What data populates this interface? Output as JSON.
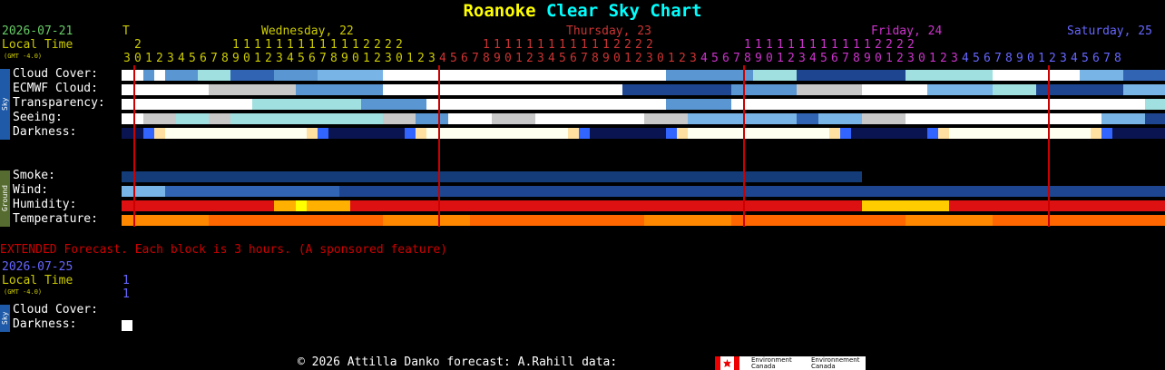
{
  "title": {
    "place": "Roanoke",
    "chart": "Clear Sky Chart"
  },
  "header": {
    "date": "2026-07-21",
    "local_time": "Local Time",
    "gmt": "(GMT -4.0)",
    "days": [
      {
        "label": "T",
        "color": "#cccc00"
      },
      {
        "label": "Wednesday, 22",
        "color": "#cccc00"
      },
      {
        "label": "Thursday, 23",
        "color": "#cc3333"
      },
      {
        "label": "Friday, 24",
        "color": "#cc33cc"
      },
      {
        "label": "Saturday, 25",
        "color": "#6666ff"
      }
    ],
    "hours_line1": " 2        1111111111112222       1111111111112222        1111111111112222",
    "hours_line2": "30123456789012345678901230123456789012345678901230123456789012345678901230123456789012345678"
  },
  "tabs": {
    "sky": "Sky",
    "ground": "Ground"
  },
  "rows": {
    "cloud": "Cloud Cover:",
    "ecmwf": "ECMWF Cloud:",
    "transparency": "Transparency:",
    "seeing": "Seeing:",
    "darkness": "Darkness:",
    "smoke": "Smoke:",
    "wind": "Wind:",
    "humidity": "Humidity:",
    "temperature": "Temperature:"
  },
  "extended": {
    "note": "EXTENDED Forecast. Each block is 3 hours. (A sponsored feature)",
    "date": "2026-07-25",
    "local_time": "Local Time",
    "gmt": "(GMT -4.0)",
    "hour_a": "1",
    "hour_b": "1",
    "cloud": "Cloud Cover:",
    "darkness": "Darkness:"
  },
  "footer": {
    "text": "© 2026 Attilla Danko  forecast: A.Rahill  data:",
    "env_en_1": "Environment",
    "env_en_2": "Canada",
    "env_fr_1": "Environnement",
    "env_fr_2": "Canada"
  },
  "colors": {
    "sky_tab": "#1e5aa8",
    "ground_tab": "#556b2f",
    "midnight_line": "#cc0000"
  }
}
